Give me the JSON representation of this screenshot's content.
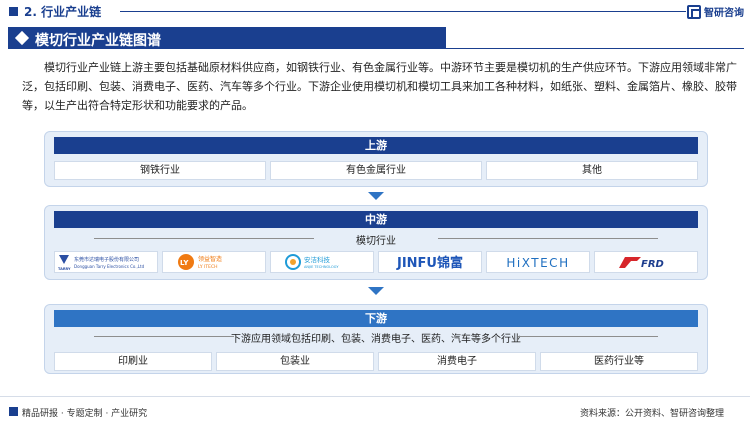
{
  "header": {
    "section": "2. 行业产业链",
    "logo_text": "智研咨询"
  },
  "banner": {
    "title": "模切行业产业链图谱"
  },
  "intro": "模切行业产业链上游主要包括基础原材料供应商，如钢铁行业、有色金属行业等。中游环节主要是模切机的生产供应环节。下游应用领域非常广泛，包括印刷、包装、消费电子、医药、汽车等多个行业。下游企业使用模切机和模切工具来加工各种材料，如纸张、塑料、金属箔片、橡胶、胶带等，以生产出符合特定形状和功能要求的产品。",
  "upstream": {
    "label": "上游",
    "items": [
      "钢铁行业",
      "有色金属行业",
      "其他"
    ]
  },
  "midstream": {
    "label": "中游",
    "sublabel": "模切行业",
    "companies": [
      {
        "name": "东莞市达瑞电子股份有限公司",
        "sub": "Dongguan Tarry Electronics Co.,Ltd",
        "mark": "TARRY",
        "color": "#2b4fa3"
      },
      {
        "name": "领益智造",
        "sub": "LY ITECH",
        "mark": "LY",
        "color": "#f07a12"
      },
      {
        "name": "安洁科技",
        "sub": "ANJIE TECHNOLOGY",
        "mark": "AJ",
        "color": "#1f9bd7"
      },
      {
        "name": "JINFU锦富",
        "color": "#1e56b8"
      },
      {
        "name": "HiXTECH",
        "color": "#1f6fc0"
      },
      {
        "name": "FRD",
        "color": "#d7262b"
      }
    ]
  },
  "downstream": {
    "label": "下游",
    "sublabel": "下游应用领域包括印刷、包装、消费电子、医药、汽车等多个行业",
    "items": [
      "印刷业",
      "包装业",
      "消费电子",
      "医药行业等"
    ]
  },
  "footer": {
    "left": "精品研报 · 专题定制 · 产业研究",
    "right": "资料来源：公开资料、智研咨询整理"
  }
}
